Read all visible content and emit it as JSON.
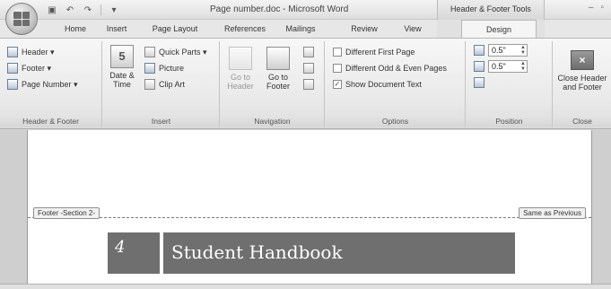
{
  "window": {
    "title": "Page number.doc - Microsoft Word",
    "context_title": "Header & Footer Tools",
    "controls": [
      "–",
      "▫"
    ]
  },
  "qat": {
    "save_icon": "save-icon",
    "undo_icon": "undo-icon",
    "redo_icon": "redo-icon",
    "customize_icon": "dropdown-icon"
  },
  "tabs": [
    "Home",
    "Insert",
    "Page Layout",
    "References",
    "Mailings",
    "Review",
    "View",
    "Design"
  ],
  "active_tab": "Design",
  "ribbon": {
    "header_footer": {
      "label": "Header & Footer",
      "header": "Header ▾",
      "footer": "Footer ▾",
      "page_number": "Page Number ▾"
    },
    "insert": {
      "label": "Insert",
      "date_time_line1": "Date &",
      "date_time_line2": "Time",
      "date_time_icon_text": "5",
      "quick_parts": "Quick Parts ▾",
      "picture": "Picture",
      "clip_art": "Clip Art"
    },
    "navigation": {
      "label": "Navigation",
      "go_to_header_line1": "Go to",
      "go_to_header_line2": "Header",
      "go_to_footer_line1": "Go to",
      "go_to_footer_line2": "Footer"
    },
    "options": {
      "label": "Options",
      "different_first_page": "Different First Page",
      "different_odd_even": "Different Odd & Even Pages",
      "show_document_text": "Show Document Text",
      "show_document_text_checked": true
    },
    "position": {
      "label": "Position",
      "header_from_top": "0.5\"",
      "footer_from_bottom": "0.5\""
    },
    "close": {
      "label": "Close",
      "close_line1": "Close Header",
      "close_line2": "and Footer"
    }
  },
  "document": {
    "footer_tag": "Footer -Section 2-",
    "same_as_previous": "Same as Previous",
    "page_number": "4",
    "footer_title": "Student Handbook"
  }
}
